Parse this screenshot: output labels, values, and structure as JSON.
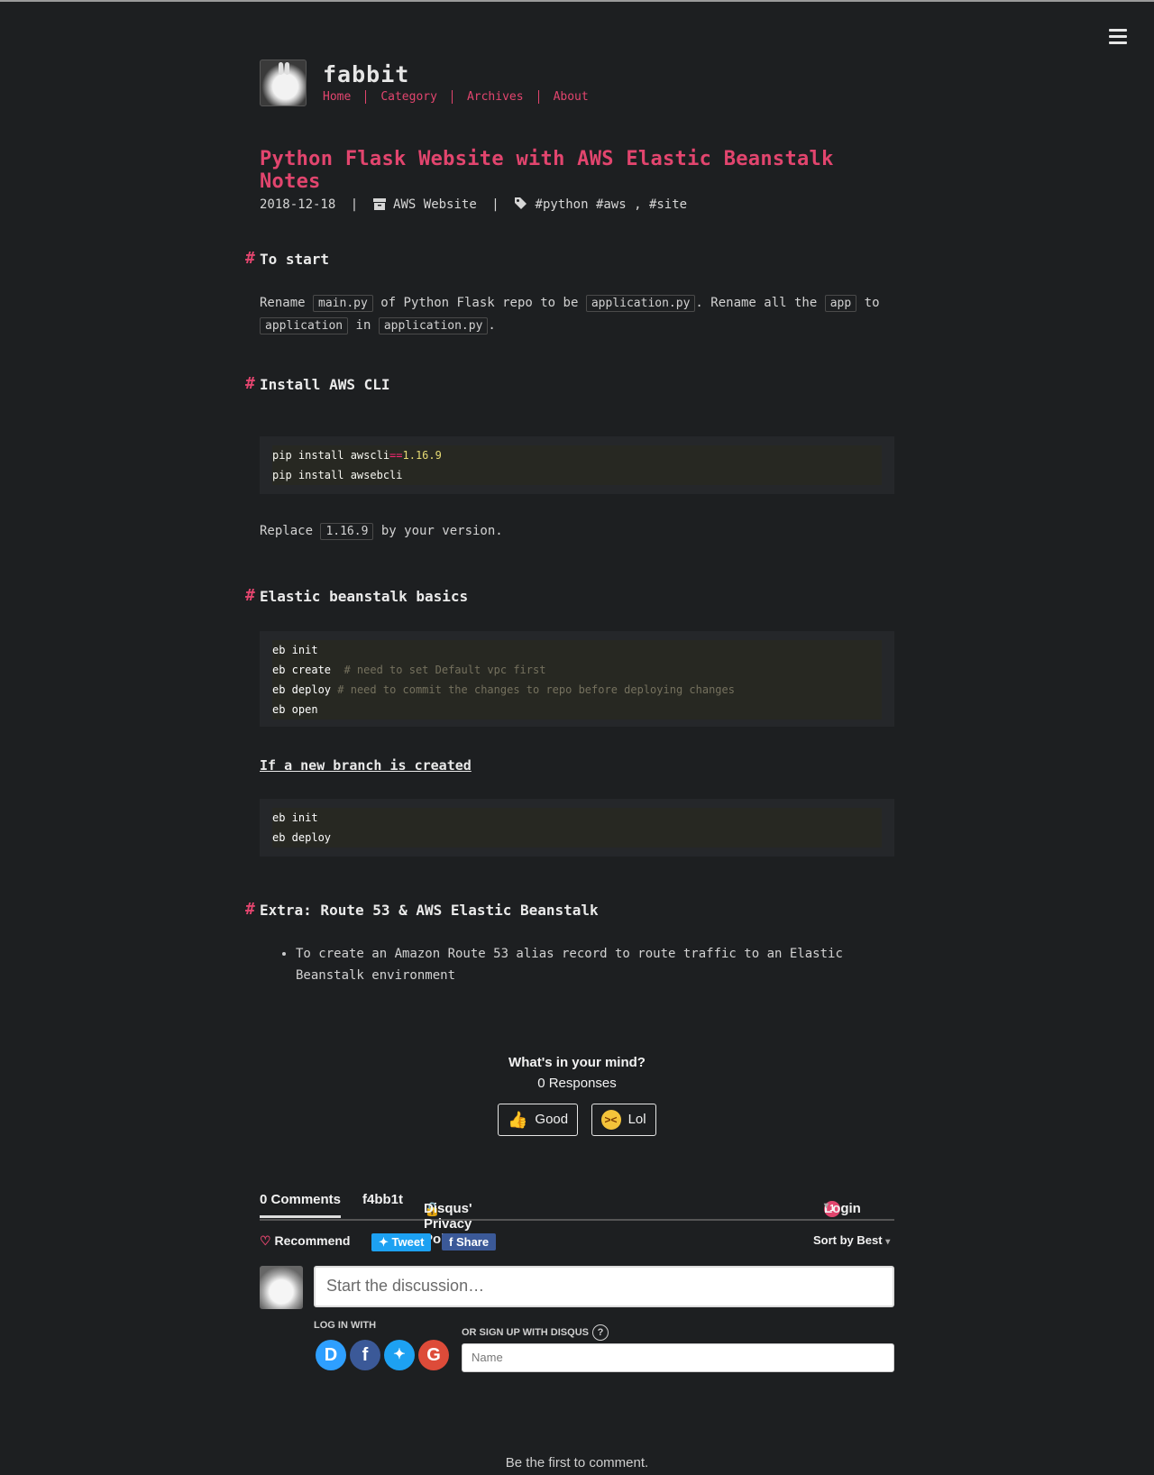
{
  "site": {
    "title": "fabbit",
    "nav": [
      "Home",
      "Category",
      "Archives",
      "About"
    ]
  },
  "post": {
    "title": "Python Flask Website with AWS Elastic Beanstalk Notes",
    "date": "2018-12-18",
    "category": "AWS Website",
    "tags": "#python #aws , #site"
  },
  "sections": {
    "start": {
      "heading": "To start",
      "p": {
        "t1": "Rename",
        "c1": "main.py",
        "t2": "of Python Flask repo to be",
        "c2": "application.py",
        "t3": ". Rename all the",
        "c3": "app",
        "t4": "to",
        "c4": "application",
        "t5": "in",
        "c5": "application.py",
        "t6": "."
      }
    },
    "install": {
      "heading": "Install AWS CLI",
      "code": {
        "l1a": "pip install awscli",
        "l1op": "==",
        "l1num": "1.16.9",
        "l2": "pip install awsebcli"
      },
      "replace": {
        "t1": "Replace",
        "c1": "1.16.9",
        "t2": "by your version."
      }
    },
    "basics": {
      "heading": "Elastic beanstalk basics",
      "code": {
        "l1": "eb init",
        "l2": "eb create",
        "l2c": "# need to set Default vpc first",
        "l3": "eb deploy",
        "l3c": "# need to commit the changes to repo before deploying changes",
        "l4": "eb open"
      },
      "branch_heading": "If a new branch is created",
      "branch_code": {
        "l1": "eb init",
        "l2": "eb deploy"
      }
    },
    "extra": {
      "heading": "Extra: Route 53 & AWS Elastic Beanstalk",
      "link_line1": "To create an Amazon Route 53 alias record to route traffic to an Elastic",
      "link_line2": "Beanstalk environment"
    }
  },
  "reactions": {
    "question": "What's in your mind?",
    "responses": "0 Responses",
    "good": "Good",
    "lol": "Lol"
  },
  "disqus": {
    "comments_tab": "0 Comments",
    "site_tab": "f4bb1t",
    "privacy": "Disqus' Privacy Policy",
    "login": "Login",
    "notif_count": "1",
    "recommend": "Recommend",
    "tweet": "Tweet",
    "share": "Share",
    "sort": "Sort by Best",
    "input_placeholder": "Start the discussion…",
    "login_with": "LOG IN WITH",
    "signup": "OR SIGN UP WITH DISQUS",
    "name_placeholder": "Name",
    "first": "Be the first to comment."
  },
  "colors": {
    "accent": "#e2456e",
    "background": "#1d1f21",
    "code_bg": "#272822"
  }
}
